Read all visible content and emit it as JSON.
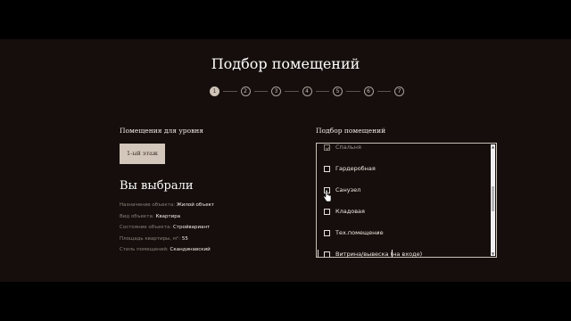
{
  "page": {
    "title": "Подбор помещений"
  },
  "steps": {
    "active_index": 0,
    "labels": [
      "1",
      "2",
      "3",
      "4",
      "5",
      "6",
      "7"
    ]
  },
  "left": {
    "level_label": "Помещения для уровня",
    "floor_button": "1-ый этаж",
    "chosen_title": "Вы выбрали",
    "info": [
      {
        "label": "Назначение объекта:",
        "value": "Жилой объект"
      },
      {
        "label": "Вид объекта:",
        "value": "Квартира"
      },
      {
        "label": "Состояние объекта:",
        "value": "Стройвариант"
      },
      {
        "label": "Площадь квартиры, м²:",
        "value": "55"
      },
      {
        "label": "Стиль помещений:",
        "value": "Скандинавский"
      }
    ]
  },
  "right": {
    "rooms_label": "Подбор помещений",
    "rooms": [
      {
        "label": "Спальня",
        "checked": true
      },
      {
        "label": "Гардеробная",
        "checked": false
      },
      {
        "label": "Санузел",
        "checked": false
      },
      {
        "label": "Кладовая",
        "checked": false
      },
      {
        "label": "Тех.помещение",
        "checked": false
      },
      {
        "label": "Витрина/вывеска (на входе)",
        "checked": false
      }
    ],
    "scroll_position": 0.48
  },
  "colors": {
    "background": "#000000",
    "panel": "#150e0c",
    "accent": "#d3c6ba",
    "muted_text": "#8b817b"
  },
  "icons": {
    "checkbox": "checkbox-icon",
    "cursor": "hand-pointer-icon"
  }
}
